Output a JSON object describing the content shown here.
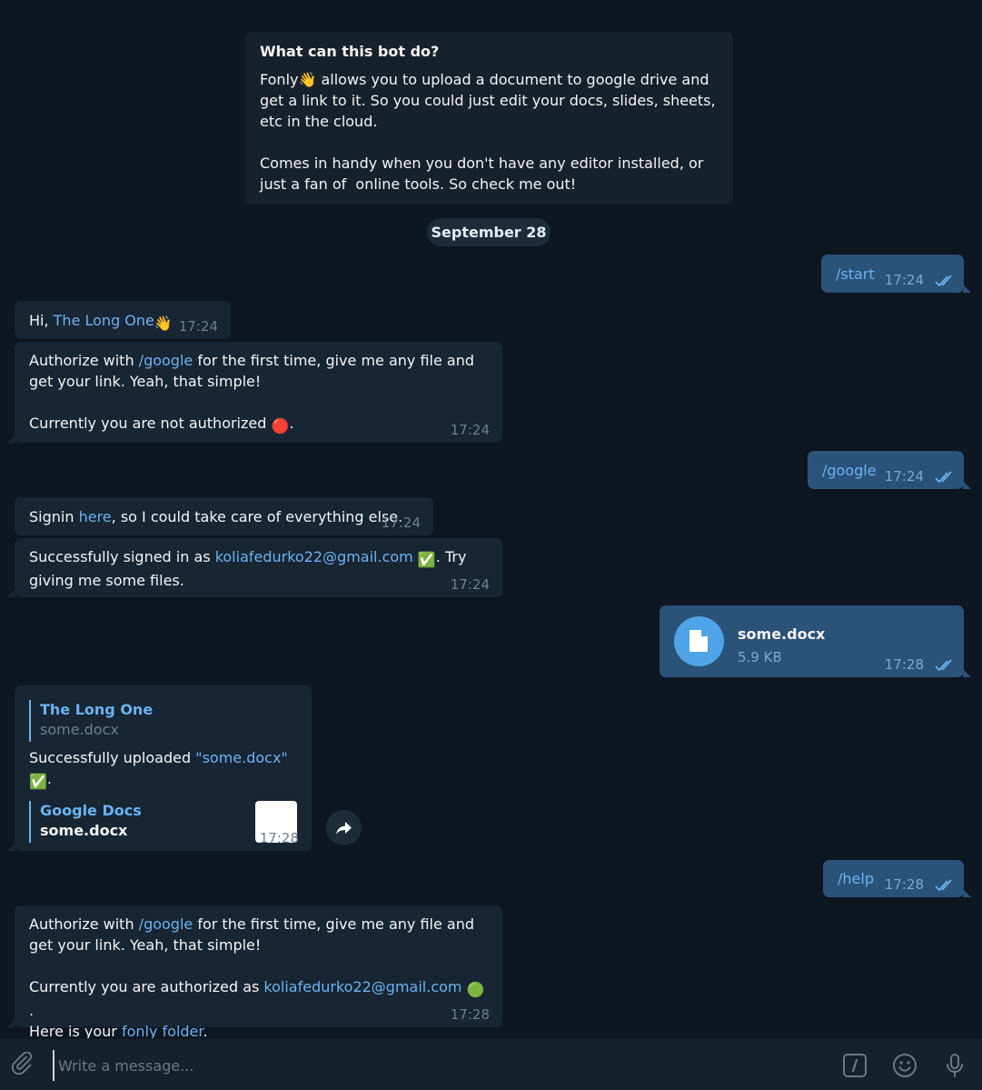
{
  "intro": {
    "title": "What can this bot do?",
    "p1": "Fonly👋 allows you to upload a document to google drive and get a link to it. So you could just edit your docs, slides, sheets, etc in the cloud.",
    "p2": "Comes in handy when you don't have any editor installed, or just a fan of  online tools. So check me out!"
  },
  "date_badge": "September 28",
  "messages": {
    "start_cmd": {
      "text": "/start",
      "time": "17:24"
    },
    "greeting": {
      "prefix": "Hi, ",
      "name": "The Long One",
      "emoji": "👋",
      "time": "17:24"
    },
    "auth1": {
      "a": "Authorize with ",
      "cmd": "/google",
      "b": " for the first time, give me any file and get your link. Yeah, that simple!",
      "c": "Currently you are not authorized ",
      "emoji": "🔴",
      "d": ".",
      "time": "17:24"
    },
    "google_cmd": {
      "text": "/google",
      "time": "17:24"
    },
    "signin": {
      "a": "Signin ",
      "link": "here",
      "b": ", so I could take care of everything else.",
      "time": "17:24"
    },
    "signed": {
      "a": "Successfully signed in as ",
      "email": "koliafedurko22@gmail.com",
      "emoji": "✅",
      "b": ". Try giving me some files.",
      "time": "17:24"
    },
    "file": {
      "name": "some.docx",
      "size": "5.9 KB",
      "time": "17:28"
    },
    "upload": {
      "reply_name": "The Long One",
      "reply_text": "some.docx",
      "a": "Successfully uploaded ",
      "link": "\"some.docx\"",
      "emoji": "✅",
      "b": ".",
      "preview_site": "Google Docs",
      "preview_title": "some.docx",
      "time": "17:28"
    },
    "help_cmd": {
      "text": "/help",
      "time": "17:28"
    },
    "auth2": {
      "a": "Authorize with ",
      "cmd": "/google",
      "b": " for the first time, give me any file and get your link. Yeah, that simple!",
      "c": "Currently you are authorized as ",
      "email": "koliafedurko22@gmail.com",
      "emoji": "🟢",
      "d": ".",
      "e": "Here is your ",
      "folder": "fonly folder",
      "f": ".",
      "time": "17:28"
    }
  },
  "composer": {
    "placeholder": "Write a message..."
  },
  "icons": {
    "attach": "paperclip-icon",
    "commands": "slash-icon",
    "emoji": "smiley-icon",
    "mic": "microphone-icon",
    "share": "share-arrow-icon",
    "read": "double-check-icon",
    "file": "document-icon"
  },
  "colors": {
    "background": "#0e1621",
    "incoming": "#182533",
    "outgoing": "#2b5278",
    "link": "#6ab3f3",
    "accent": "#4ea4e6"
  }
}
